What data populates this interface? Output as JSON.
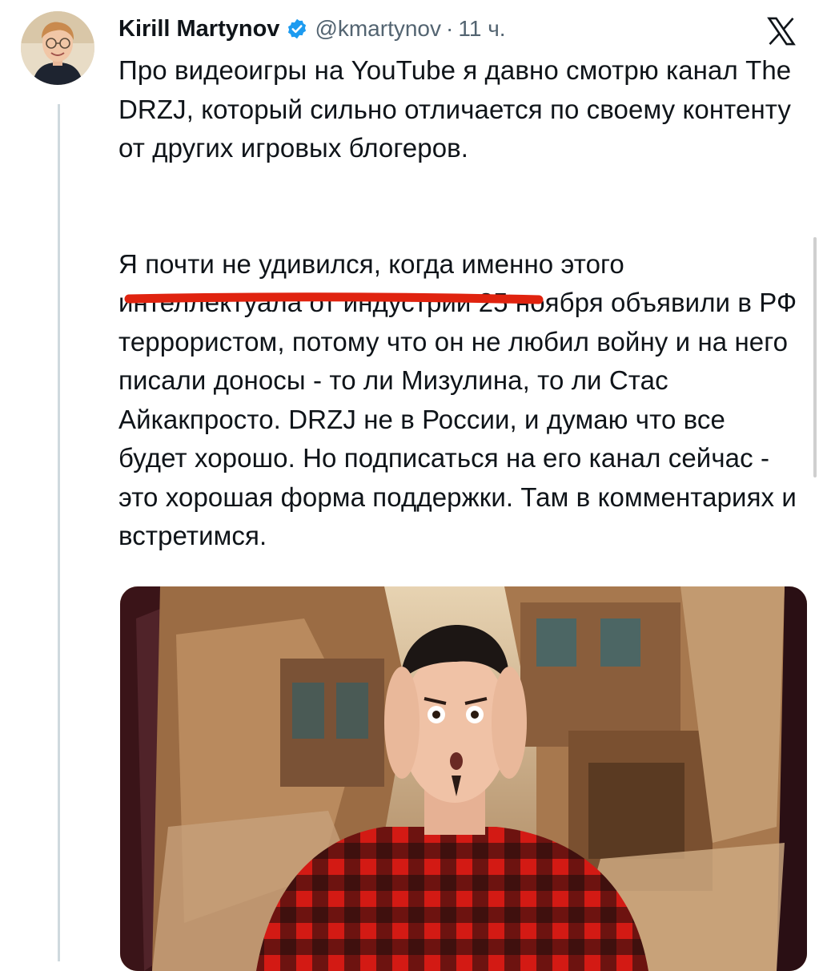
{
  "tweet": {
    "author_name": "Kirill Martynov",
    "handle": "@kmartynov",
    "separator": "·",
    "time": "11 ч.",
    "paragraph_1": "Про видеоигры на YouTube я давно смотрю канал The DRZJ, который сильно отличается по своему контенту от других игровых блогеров.",
    "paragraph_2": "Я почти не удивился, когда именно этого интеллектуала от индустрии 25 ноября объявили в РФ террористом, потому что он не любил войну и на него писали доносы - то ли Мизулина, то ли Стас Айкакпросто. DRZJ не в России, и думаю что все будет хорошо. Но подписаться на его канал сейчас - это хорошая форма поддержки. Там в комментариях и встретимся."
  },
  "icons": {
    "verified": "verified-badge-icon",
    "platform": "x-logo-icon"
  },
  "colors": {
    "verified_blue": "#1d9bf0",
    "annotation_red": "#e0230f",
    "secondary_text": "#536471",
    "thread_line": "#cfd9de"
  }
}
